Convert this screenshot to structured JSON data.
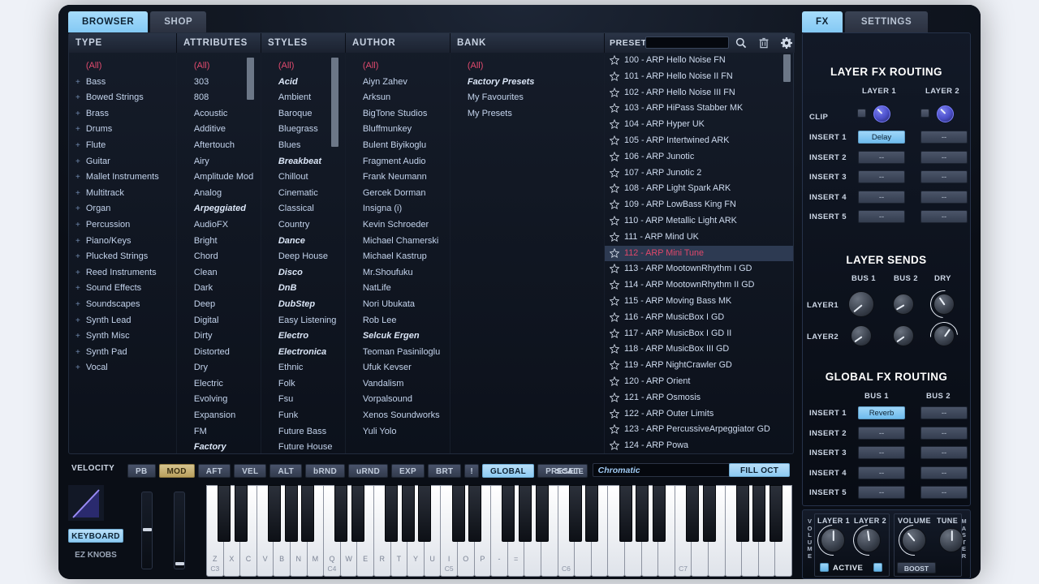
{
  "app": {
    "left_tabs": [
      {
        "label": "BROWSER",
        "active": true
      },
      {
        "label": "SHOP",
        "active": false
      }
    ],
    "right_tabs": [
      {
        "label": "FX",
        "active": true
      },
      {
        "label": "SETTINGS",
        "active": false
      }
    ]
  },
  "browser": {
    "columns": [
      {
        "header": "TYPE",
        "items": [
          {
            "label": "(All)",
            "all": true
          },
          {
            "label": "Bass",
            "expand": "+"
          },
          {
            "label": "Bowed Strings",
            "expand": "+"
          },
          {
            "label": "Brass",
            "expand": "+"
          },
          {
            "label": "Drums",
            "expand": "+"
          },
          {
            "label": "Flute",
            "expand": "+"
          },
          {
            "label": "Guitar",
            "expand": "+"
          },
          {
            "label": "Mallet Instruments",
            "expand": "+"
          },
          {
            "label": "Multitrack",
            "expand": "+"
          },
          {
            "label": "Organ",
            "expand": "+"
          },
          {
            "label": "Percussion",
            "expand": "+"
          },
          {
            "label": "Piano/Keys",
            "expand": "+"
          },
          {
            "label": "Plucked Strings",
            "expand": "+"
          },
          {
            "label": "Reed Instruments",
            "expand": "+"
          },
          {
            "label": "Sound Effects",
            "expand": "+"
          },
          {
            "label": "Soundscapes",
            "expand": "+"
          },
          {
            "label": "Synth Lead",
            "expand": "+"
          },
          {
            "label": "Synth Misc",
            "expand": "+"
          },
          {
            "label": "Synth Pad",
            "expand": "+"
          },
          {
            "label": "Vocal",
            "expand": "+"
          }
        ]
      },
      {
        "header": "ATTRIBUTES",
        "items": [
          {
            "label": "(All)",
            "all": true
          },
          {
            "label": "303"
          },
          {
            "label": "808"
          },
          {
            "label": "Acoustic"
          },
          {
            "label": "Additive"
          },
          {
            "label": "Aftertouch"
          },
          {
            "label": "Airy"
          },
          {
            "label": "Amplitude Mod"
          },
          {
            "label": "Analog"
          },
          {
            "label": "Arpeggiated",
            "italic": true
          },
          {
            "label": "AudioFX"
          },
          {
            "label": "Bright"
          },
          {
            "label": "Chord"
          },
          {
            "label": "Clean"
          },
          {
            "label": "Dark"
          },
          {
            "label": "Deep"
          },
          {
            "label": "Digital"
          },
          {
            "label": "Dirty"
          },
          {
            "label": "Distorted"
          },
          {
            "label": "Dry"
          },
          {
            "label": "Electric"
          },
          {
            "label": "Evolving"
          },
          {
            "label": "Expansion"
          },
          {
            "label": "FM"
          },
          {
            "label": "Factory",
            "italic": true
          }
        ]
      },
      {
        "header": "STYLES",
        "items": [
          {
            "label": "(All)",
            "all": true
          },
          {
            "label": "Acid",
            "italic": true
          },
          {
            "label": "Ambient"
          },
          {
            "label": "Baroque"
          },
          {
            "label": "Bluegrass"
          },
          {
            "label": "Blues"
          },
          {
            "label": "Breakbeat",
            "italic": true
          },
          {
            "label": "Chillout"
          },
          {
            "label": "Cinematic"
          },
          {
            "label": "Classical"
          },
          {
            "label": "Country"
          },
          {
            "label": "Dance",
            "italic": true
          },
          {
            "label": "Deep House"
          },
          {
            "label": "Disco",
            "italic": true
          },
          {
            "label": "DnB",
            "italic": true
          },
          {
            "label": "DubStep",
            "italic": true
          },
          {
            "label": "Easy Listening"
          },
          {
            "label": "Electro",
            "italic": true
          },
          {
            "label": "Electronica",
            "italic": true
          },
          {
            "label": "Ethnic"
          },
          {
            "label": "Folk"
          },
          {
            "label": "Fsu"
          },
          {
            "label": "Funk"
          },
          {
            "label": "Future Bass"
          },
          {
            "label": "Future House"
          }
        ]
      },
      {
        "header": "AUTHOR",
        "items": [
          {
            "label": "(All)",
            "all": true
          },
          {
            "label": "Aiyn Zahev"
          },
          {
            "label": "Arksun"
          },
          {
            "label": "BigTone Studios"
          },
          {
            "label": "Bluffmunkey"
          },
          {
            "label": "Bulent Biyikoglu"
          },
          {
            "label": "Fragment Audio"
          },
          {
            "label": "Frank Neumann"
          },
          {
            "label": "Gercek Dorman"
          },
          {
            "label": "Insigna (i)"
          },
          {
            "label": "Kevin Schroeder"
          },
          {
            "label": "Michael Chamerski"
          },
          {
            "label": "Michael Kastrup"
          },
          {
            "label": "Mr.Shoufuku"
          },
          {
            "label": "NatLife"
          },
          {
            "label": "Nori Ubukata"
          },
          {
            "label": "Rob Lee"
          },
          {
            "label": "Selcuk Ergen",
            "italic": true
          },
          {
            "label": "Teoman Pasiniloglu"
          },
          {
            "label": "Ufuk Kevser"
          },
          {
            "label": "Vandalism"
          },
          {
            "label": "Vorpalsound"
          },
          {
            "label": "Xenos Soundworks"
          },
          {
            "label": "Yuli Yolo"
          }
        ]
      },
      {
        "header": "BANK",
        "items": [
          {
            "label": "(All)",
            "all": true
          },
          {
            "label": "Factory Presets",
            "italic": true
          },
          {
            "label": "My Favourites"
          },
          {
            "label": "My Presets"
          }
        ]
      }
    ],
    "preset_bar": {
      "label": "PRESET",
      "search_value": "",
      "search_placeholder": "",
      "icons": [
        "search-icon",
        "trash-icon",
        "gear-icon"
      ]
    },
    "presets": [
      {
        "num": "100",
        "name": "ARP Hello Noise FN"
      },
      {
        "num": "101",
        "name": "ARP Hello Noise II FN"
      },
      {
        "num": "102",
        "name": "ARP Hello Noise III FN"
      },
      {
        "num": "103",
        "name": "ARP HiPass Stabber MK"
      },
      {
        "num": "104",
        "name": "ARP Hyper UK"
      },
      {
        "num": "105",
        "name": "ARP Intertwined ARK"
      },
      {
        "num": "106",
        "name": "ARP Junotic"
      },
      {
        "num": "107",
        "name": "ARP Junotic 2"
      },
      {
        "num": "108",
        "name": "ARP Light Spark ARK"
      },
      {
        "num": "109",
        "name": "ARP LowBass King FN"
      },
      {
        "num": "110",
        "name": "ARP Metallic Light ARK"
      },
      {
        "num": "111",
        "name": "ARP Mind UK"
      },
      {
        "num": "112",
        "name": "ARP Mini Tune",
        "selected": true
      },
      {
        "num": "113",
        "name": "ARP MootownRhythm I GD"
      },
      {
        "num": "114",
        "name": "ARP MootownRhythm II GD"
      },
      {
        "num": "115",
        "name": "ARP Moving Bass MK"
      },
      {
        "num": "116",
        "name": "ARP MusicBox I GD"
      },
      {
        "num": "117",
        "name": "ARP MusicBox I GD II"
      },
      {
        "num": "118",
        "name": "ARP MusicBox III GD"
      },
      {
        "num": "119",
        "name": "ARP NightCrawler GD"
      },
      {
        "num": "120",
        "name": "ARP Orient"
      },
      {
        "num": "121",
        "name": "ARP Osmosis"
      },
      {
        "num": "122",
        "name": "ARP Outer Limits"
      },
      {
        "num": "123",
        "name": "ARP PercussiveArpeggiator GD"
      },
      {
        "num": "124",
        "name": "ARP Powa"
      }
    ]
  },
  "perform": {
    "velocity_label": "VELOCITY",
    "keyboard_label": "KEYBOARD",
    "ez_knobs_label": "EZ KNOBS",
    "buttons": [
      {
        "label": "PB",
        "state": "off"
      },
      {
        "label": "MOD",
        "state": "mod"
      },
      {
        "label": "AFT",
        "state": "off"
      },
      {
        "label": "VEL",
        "state": "off"
      },
      {
        "label": "ALT",
        "state": "off"
      },
      {
        "label": "bRND",
        "state": "off"
      },
      {
        "label": "uRND",
        "state": "off"
      },
      {
        "label": "EXP",
        "state": "off"
      },
      {
        "label": "BRT",
        "state": "off"
      },
      {
        "label": "!",
        "state": "off"
      },
      {
        "label": "GLOBAL",
        "state": "on"
      },
      {
        "label": "PRESET",
        "state": "off"
      }
    ],
    "scale_label": "SCALE",
    "scale_value": "Chromatic",
    "fill_oct_label": "FILL OCT",
    "key_labels": [
      "Z",
      "X",
      "C",
      "V",
      "B",
      "N",
      "M",
      "Q",
      "W",
      "E",
      "R",
      "T",
      "Y",
      "U",
      "I",
      "O",
      "P",
      "-",
      "="
    ],
    "octave_marks": [
      {
        "key_index": 0,
        "label": "C3"
      },
      {
        "key_index": 7,
        "label": "C4"
      },
      {
        "key_index": 14,
        "label": "C5"
      },
      {
        "key_index": 21,
        "label": "C6"
      },
      {
        "key_index": 28,
        "label": "C7"
      }
    ]
  },
  "fx": {
    "layer_routing": {
      "title": "LAYER FX ROUTING",
      "col_headers": [
        "LAYER 1",
        "LAYER 2"
      ],
      "clip_label": "CLIP",
      "rows": [
        {
          "label": "INSERT 1",
          "layer1": "Delay",
          "layer1_on": true,
          "layer2": "--",
          "layer2_on": false
        },
        {
          "label": "INSERT 2",
          "layer1": "--",
          "layer1_on": false,
          "layer2": "--",
          "layer2_on": false
        },
        {
          "label": "INSERT 3",
          "layer1": "--",
          "layer1_on": false,
          "layer2": "--",
          "layer2_on": false
        },
        {
          "label": "INSERT 4",
          "layer1": "--",
          "layer1_on": false,
          "layer2": "--",
          "layer2_on": false
        },
        {
          "label": "INSERT 5",
          "layer1": "--",
          "layer1_on": false,
          "layer2": "--",
          "layer2_on": false
        }
      ]
    },
    "layer_sends": {
      "title": "LAYER SENDS",
      "col_headers": [
        "BUS 1",
        "BUS 2",
        "DRY"
      ],
      "row_labels": [
        "LAYER1",
        "LAYER2"
      ],
      "knob_angles": [
        [
          -130,
          -120,
          -35
        ],
        [
          -125,
          -125,
          35
        ]
      ]
    },
    "global_routing": {
      "title": "GLOBAL FX ROUTING",
      "col_headers": [
        "BUS 1",
        "BUS 2"
      ],
      "rows": [
        {
          "label": "INSERT 1",
          "bus1": "Reverb",
          "bus1_on": true,
          "bus2": "--",
          "bus2_on": false
        },
        {
          "label": "INSERT 2",
          "bus1": "--",
          "bus1_on": false,
          "bus2": "--",
          "bus2_on": false
        },
        {
          "label": "INSERT 3",
          "bus1": "--",
          "bus1_on": false,
          "bus2": "--",
          "bus2_on": false
        },
        {
          "label": "INSERT 4",
          "bus1": "--",
          "bus1_on": false,
          "bus2": "--",
          "bus2_on": false
        },
        {
          "label": "INSERT 5",
          "bus1": "--",
          "bus1_on": false,
          "bus2": "--",
          "bus2_on": false
        }
      ]
    }
  },
  "master": {
    "volume_vertical": "VOLUME",
    "master_vertical": "MASTER",
    "layer1_label": "LAYER 1",
    "layer2_label": "LAYER 2",
    "active_label": "ACTIVE",
    "volume_label": "VOLUME",
    "tune_label": "TUNE",
    "boost_label": "BOOST",
    "knob_angles": [
      0,
      -8,
      -40,
      0
    ]
  },
  "colors": {
    "accent_blue": "#8dcaf2",
    "accent_red": "#e0486b",
    "mod_gold": "#b99f5d",
    "text": "#c3d3ec"
  }
}
